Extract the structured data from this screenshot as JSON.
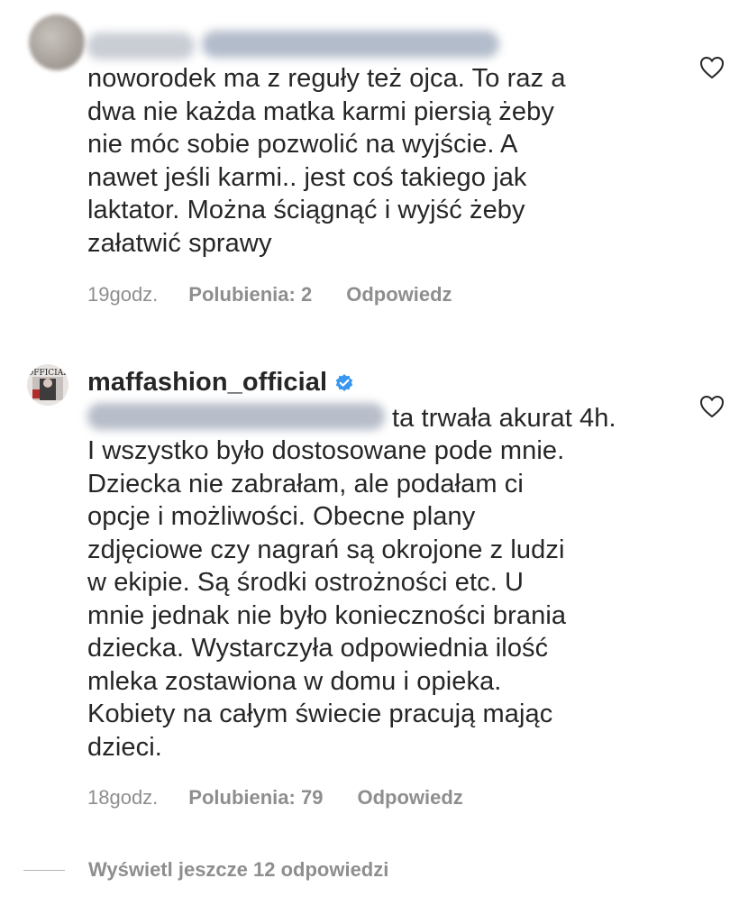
{
  "comments": [
    {
      "text": "noworodek ma  z reguły też ojca. To raz a\ndwa nie każda matka karmi piersią żeby\nnie móc sobie pozwolić na wyjście. A\nnawet jeśli karmi.. jest coś takiego jak\nlaktator. Można ściągnąć i wyjść żeby\nzałatwić sprawy",
      "time": "19godz.",
      "likes": "Polubienia: 2",
      "reply": "Odpowiedz",
      "like_icon": "heart-outline-icon"
    },
    {
      "username": "maffashion_official",
      "verified_icon": "verified-badge-icon",
      "text_first": "ta trwała akurat 4h.",
      "text": "I wszystko było dostosowane pode mnie.\nDziecka nie zabrałam, ale podałam ci\nopcje i możliwości. Obecne plany\nzdjęciowe czy nagrań są okrojone z ludzi\nw ekipie. Są środki ostrożności etc. U\nmnie jednak nie było konieczności brania\ndziecka. Wystarczyła odpowiednia ilość\nmleka zostawiona w domu i opieka.\nKobiety na całym świecie pracują mając\ndzieci.",
      "time": "18godz.",
      "likes": "Polubienia: 79",
      "reply": "Odpowiedz",
      "like_icon": "heart-outline-icon"
    }
  ],
  "view_more": "Wyświetl jeszcze 12 odpowiedzi",
  "colors": {
    "text": "#262626",
    "secondary": "#8e8e8e",
    "verified": "#3897f0"
  }
}
